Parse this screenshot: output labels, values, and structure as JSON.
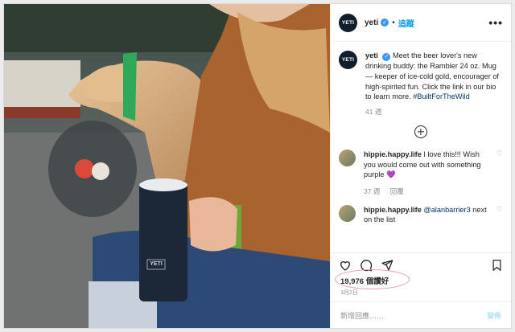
{
  "header": {
    "avatar_text": "YETI",
    "username": "yeti",
    "verified_mark": "✓",
    "follow_label": "追蹤",
    "more_label": "•••"
  },
  "caption": {
    "avatar_text": "YETI",
    "username": "yeti",
    "verified_mark": "✓",
    "text": "Meet the beer lover's new drinking buddy: the Rambler 24 oz. Mug — keeper of ice-cold gold, encourager of high-spirited fun. Click the link in our bio to learn more.",
    "hashtag": "#BuiltForTheWild",
    "age": "41 週"
  },
  "comments": [
    {
      "username": "hippie.happy.life",
      "text": "I love this!!! Wish you would come out with something purple 💜",
      "age": "37 週",
      "reply_label": "回覆"
    },
    {
      "username": "hippie.happy.life",
      "mention": "@alanbarrier3",
      "text": "next on the list"
    }
  ],
  "likes": "19,976 個讚好",
  "date": "3月2日",
  "add_comment": {
    "placeholder": "新增回應……",
    "post_label": "發佈"
  },
  "photo": {
    "mug_logo": "YETI"
  },
  "icons": [
    "more-icon",
    "verified-icon",
    "load-more-icon",
    "like-icon",
    "comment-icon",
    "share-icon",
    "bookmark-icon"
  ],
  "colors": {
    "link": "#0095f6",
    "verified": "#3897f0",
    "highlight": "#e8a0b0"
  }
}
